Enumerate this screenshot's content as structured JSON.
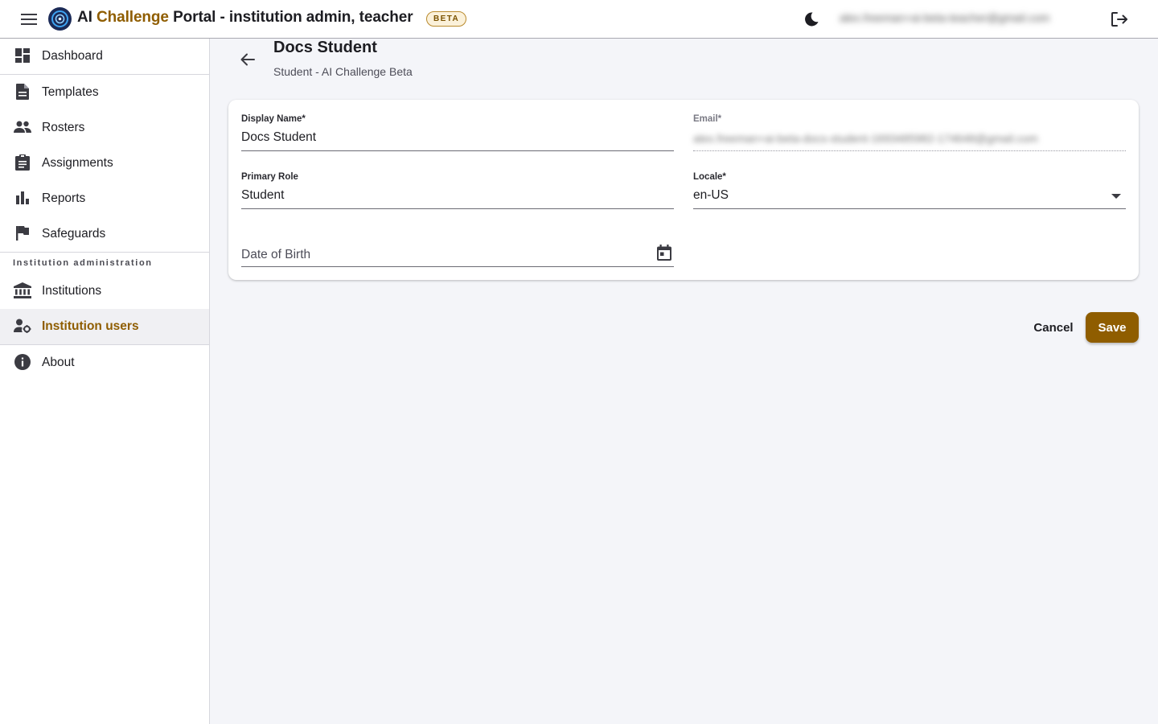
{
  "app": {
    "title_prefix": "AI",
    "title_accent": "Challenge",
    "title_suffix": "Portal - institution admin, teacher",
    "badge": "BETA",
    "user_email": "alex.freeman+ai-beta-teacher@gmail.com"
  },
  "icons": {
    "menu": "menu-icon",
    "theme": "moon-icon",
    "logout": "logout-icon",
    "back": "arrow-back-icon",
    "calendar": "calendar-icon"
  },
  "colors": {
    "accent": "#8f5d00",
    "logo": "#1b2a57"
  },
  "sidebar": {
    "items": [
      {
        "label": "Dashboard"
      },
      {
        "label": "Templates"
      },
      {
        "label": "Rosters"
      },
      {
        "label": "Assignments"
      },
      {
        "label": "Reports"
      },
      {
        "label": "Safeguards"
      },
      {
        "label": "Institutions"
      },
      {
        "label": "Institution users"
      },
      {
        "label": "About"
      }
    ],
    "section_label": "Institution administration",
    "active_item": "Institution users"
  },
  "page": {
    "title": "Docs Student",
    "subtitle": "Student - AI Challenge Beta"
  },
  "form": {
    "display_name": {
      "label": "Display Name*",
      "value": "Docs Student"
    },
    "email": {
      "label": "Email*",
      "value": "alex.freeman+ai-beta-docs-student-1693485982-174648@gmail.com"
    },
    "primary_role": {
      "label": "Primary Role",
      "value": "Student"
    },
    "locale": {
      "label": "Locale*",
      "value": "en-US"
    },
    "date_of_birth": {
      "placeholder": "Date of Birth"
    }
  },
  "actions": {
    "cancel_label": "Cancel",
    "save_label": "Save"
  }
}
